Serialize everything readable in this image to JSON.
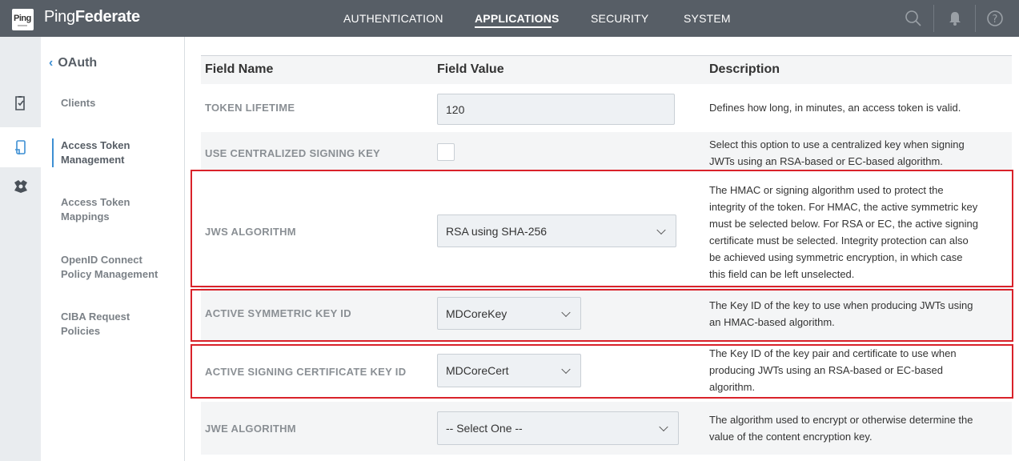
{
  "app": {
    "logo_text": "Ping",
    "brand_regular": "Ping",
    "brand_bold": "Federate"
  },
  "nav": {
    "items": [
      {
        "label": "AUTHENTICATION",
        "active": false
      },
      {
        "label": "APPLICATIONS",
        "active": true
      },
      {
        "label": "SECURITY",
        "active": false
      },
      {
        "label": "SYSTEM",
        "active": false
      }
    ],
    "icons": [
      "search-icon",
      "bell-icon",
      "help-icon"
    ]
  },
  "rail": {
    "icons": [
      "clipboard-check-icon",
      "phone-document-icon",
      "shield-network-icon"
    ]
  },
  "subnav": {
    "title": "OAuth",
    "items": [
      {
        "label_lines": [
          "Clients"
        ],
        "active": false
      },
      {
        "label_lines": [
          "Access Token",
          "Management"
        ],
        "active": true
      },
      {
        "label_lines": [
          "Access Token",
          "Mappings"
        ],
        "active": false
      },
      {
        "label_lines": [
          "OpenID Connect",
          "Policy Management"
        ],
        "active": false
      },
      {
        "label_lines": [
          "CIBA Request",
          "Policies"
        ],
        "active": false
      }
    ]
  },
  "table": {
    "headers": {
      "name": "Field Name",
      "value": "Field Value",
      "description": "Description"
    },
    "rows": [
      {
        "name": "TOKEN LIFETIME",
        "control": "text",
        "value": "120",
        "description": "Defines how long, in minutes, an access token is valid."
      },
      {
        "name": "USE CENTRALIZED SIGNING KEY",
        "control": "checkbox",
        "checked": false,
        "description_lines": [
          "Select this option to use a centralized key when signing",
          "JWTs using an RSA-based or EC-based algorithm."
        ]
      },
      {
        "name": "JWS ALGORITHM",
        "control": "select",
        "value": "RSA using SHA-256",
        "description_lines": [
          "The HMAC or signing algorithm used to protect the",
          "integrity of the token. For HMAC, the active symmetric key",
          "must be selected below. For RSA or EC, the active signing",
          "certificate must be selected. Integrity protection can also",
          "be achieved using symmetric encryption, in which case",
          "this field can be left unselected."
        ]
      },
      {
        "name": "ACTIVE SYMMETRIC KEY ID",
        "control": "select",
        "value": "MDCoreKey",
        "description_lines": [
          "The Key ID of the key to use when producing JWTs using",
          "an HMAC-based algorithm."
        ]
      },
      {
        "name": "ACTIVE SIGNING CERTIFICATE KEY ID",
        "control": "select",
        "value": "MDCoreCert",
        "description_lines": [
          "The Key ID of the key pair and certificate to use when",
          "producing JWTs using an RSA-based or EC-based",
          "algorithm."
        ]
      },
      {
        "name": "JWE ALGORITHM",
        "control": "select",
        "value": "-- Select One --",
        "description_lines": [
          "The algorithm used to encrypt or otherwise determine the",
          "value of the content encryption key."
        ]
      }
    ]
  },
  "colors": {
    "topbar": "#575e66",
    "accent": "#3d8fd3",
    "highlight": "#d9222a"
  }
}
